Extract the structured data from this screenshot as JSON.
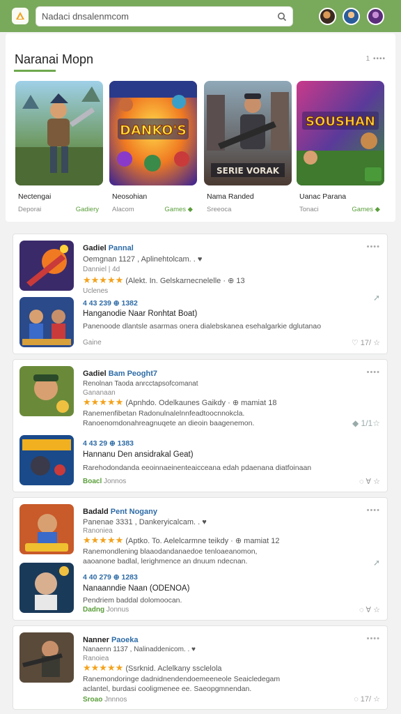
{
  "header": {
    "search_placeholder": "Nadaci dnsalenmcom"
  },
  "featured": {
    "title": "Naranai Mopn",
    "more": "1 ••••",
    "items": [
      {
        "name": "Nectengai",
        "sub": "Deporai",
        "genre": "Gadiery",
        "art": "hero"
      },
      {
        "name": "Neosohian",
        "sub": "Alacom",
        "genre": "Games ◆",
        "art": "danko",
        "caption": "DANKO'S"
      },
      {
        "name": "Nama Randed",
        "sub": "Sreeoca",
        "genre": "",
        "art": "soldier",
        "caption": "SERIE VORAK"
      },
      {
        "name": "Uanac Parana",
        "sub": "Tonaci",
        "genre": "Games ◆",
        "art": "soushan",
        "caption": "SOUSHAN"
      }
    ]
  },
  "cards": [
    {
      "title": "Gadiel",
      "title_accent": "Pannal",
      "line1": "Oemgnan  1127  ,  Aplinehtolcam.  .  ♥",
      "line2": "Danniel  | 4d",
      "rating_text": "(Alekt. In. Gelskarnecnelelle  ·  ⊕  13",
      "line4": "Uclenes",
      "stat": "4 43 239  ⊕ 1382",
      "subtitle": "Hanganodie Naar Ronhtat Boat)",
      "desc": "Panenoode dlantsle asarmas onera dialebskanea esehalgarkie dglutanao",
      "tag": "Gaine",
      "tag_green": false,
      "foot": "♡  17/  ☆",
      "side": "➚"
    },
    {
      "title": "Gadiel",
      "title_accent": "Bam Peoght7",
      "line1": "Renolnan  Taoda  anrcctapsofcomanat",
      "line2": "Gananaan",
      "rating_text": "(Apnhdo. Odelkaunes  Gaikdy  ·  ⊕ mamiat  18",
      "line4": "Ranemenfibetan  Radonulnalelnnfeadtoocnnokcla.",
      "stat": "4 43  29  ⊕ 1383",
      "subtitle": "Hannanu  Den  ansidrakal  Geat)",
      "desc": "Rarehodondanda eeoinnaeinenteaicceana edah pdaenana diatfoinaan",
      "tag": "Boacl",
      "tag_extra": "Jonnos",
      "tag_green": true,
      "foot": "◌  ∀  ☆",
      "side": "◆ 1/1☆",
      "line5": "Ranoenomdonahreagnuqete an dieoin baagenemon."
    },
    {
      "title": "Badald",
      "title_accent": "Pent Nogany",
      "line1": "Panenae  3331  ,  Dankeryicalcam.  .  ♥",
      "line2": "Ranoniea",
      "rating_text": "(Aptko. To. Aelelcarmne  teikdy  ·  ⊕ mamiat  12",
      "line4": "Ranemondlening blaaodandanaedoe tenloaeanomon,",
      "line5": "aaoanone badlal, lerighmence an dnuum ndecnan.",
      "stat": "4 40  279  ⊕ 1283",
      "subtitle": "Nanaanndie Naan (ODENOA)",
      "desc": "Pendriem baddal dolomoocan.",
      "tag": "Dadng",
      "tag_extra": "Jonnus",
      "tag_green": true,
      "foot": "◌  ∀  ☆",
      "side": "➚"
    },
    {
      "title": "Nanner",
      "title_accent": "Paoeka",
      "line1": "Nanaenn  1137  ,  Nalinaddenicom.  .  ♥",
      "line2": "Ranoiea",
      "rating_text": "(Ssrknid. Aclelkany  ssclelola",
      "line4": "Ranemondoringe dadnidnendendoemeeneole Seaicledegam",
      "line5": "aclantel, burdasi cooligmenee  ee. Saeopgmnendan.",
      "tag": "Sroao",
      "tag_extra": "Jnnnos",
      "tag_green": true,
      "foot": "◌  17/  ☆"
    }
  ]
}
